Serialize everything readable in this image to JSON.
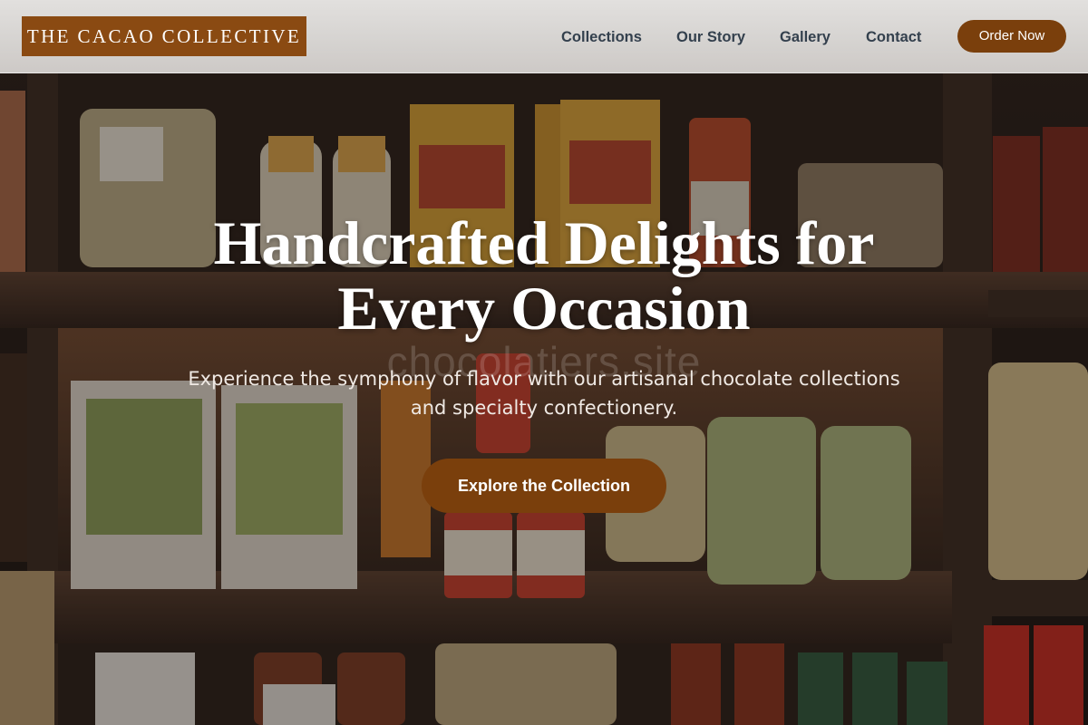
{
  "brand": {
    "name": "THE CACAO COLLECTIVE",
    "color": "#8a4a12"
  },
  "nav": {
    "items": [
      {
        "label": "Collections"
      },
      {
        "label": "Our Story"
      },
      {
        "label": "Gallery"
      },
      {
        "label": "Contact"
      }
    ],
    "order_label": "Order Now"
  },
  "hero": {
    "title_line1": "Handcrafted Delights for",
    "title_line2": "Every Occasion",
    "subtitle_line1": "Experience the symphony of flavor with our artisanal chocolate collections",
    "subtitle_line2": "and specialty confectionery.",
    "cta_label": "Explore the Collection",
    "watermark": "chocolatiers.site"
  },
  "colors": {
    "accent": "#7a3f0c",
    "nav_text": "#22303f",
    "header_bg": "#e2e0de"
  }
}
